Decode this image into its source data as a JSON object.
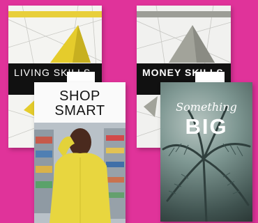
{
  "background_color": "#e0339a",
  "books": {
    "living_skills": {
      "series": "",
      "title": "LIVING SKILLS",
      "subtitle": "",
      "accent_color": "#e8cf3a"
    },
    "money_skills": {
      "series": "",
      "title": "MONEY SKILLS",
      "subtitle": "",
      "accent_color": "#9c9d96"
    },
    "shop_smart": {
      "title_line1": "SHOP",
      "title_line2": "SMART"
    },
    "something_big": {
      "title_line1": "Something",
      "title_line2": "BIG",
      "author": ""
    }
  }
}
